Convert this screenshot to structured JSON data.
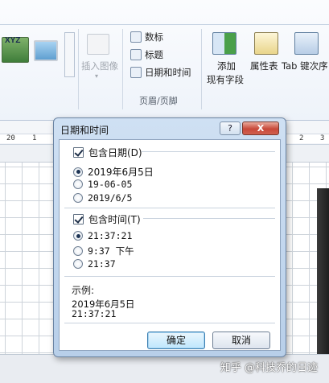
{
  "ribbon": {
    "insert_image_label": "插入图像",
    "page_number_label": "数标",
    "title_label": "标题",
    "date_time_label": "日期和时间",
    "header_footer_group": "页眉/页脚",
    "add_existing_fields_line1": "添加",
    "add_existing_fields_line2": "现有字段",
    "property_sheet_label": "属性表",
    "tab_order_label": "Tab 键次序",
    "xyz_icon_text": "XYZ"
  },
  "ruler": {
    "marks": [
      "20",
      "1",
      "2",
      "3"
    ]
  },
  "dialog": {
    "title": "日期和时间",
    "help_label": "?",
    "close_label": "X",
    "include_date_label": "包含日期(D)",
    "include_date_checked": true,
    "date_formats": [
      "2019年6月5日",
      "19-06-05",
      "2019/6/5"
    ],
    "date_selected_index": 0,
    "include_time_label": "包含时间(T)",
    "include_time_checked": true,
    "time_formats": [
      "21:37:21",
      "9:37 下午",
      "21:37"
    ],
    "time_selected_index": 0,
    "example_label": "示例:",
    "example_line1": "2019年6月5日",
    "example_line2": "21:37:21",
    "ok_label": "确定",
    "cancel_label": "取消"
  },
  "watermark": "知乎 @科技乔的日迹",
  "colors": {
    "dialog_frame": "#b8cfe9",
    "close_button": "#c8493a",
    "default_button": "#bee6fd"
  }
}
